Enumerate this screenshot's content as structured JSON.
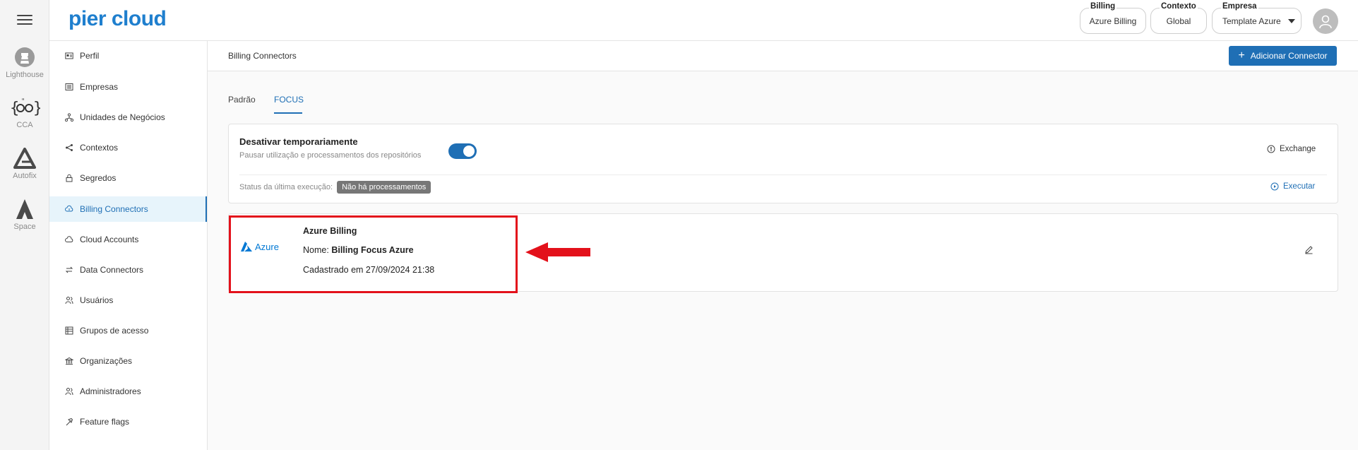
{
  "rail": {
    "items": [
      {
        "label": "Lighthouse",
        "icon": "lighthouse-icon"
      },
      {
        "label": "CCA",
        "icon": "cca-icon"
      },
      {
        "label": "Autofix",
        "icon": "autofix-icon"
      },
      {
        "label": "Space",
        "icon": "space-icon"
      }
    ]
  },
  "header": {
    "logo": "pier cloud",
    "billing_label": "Billing",
    "billing_value": "Azure Billing",
    "context_label": "Contexto",
    "context_value": "Global",
    "company_label": "Empresa",
    "company_value": "Template Azure"
  },
  "sidebar": {
    "items": [
      {
        "label": "Perfil",
        "icon": "id-card-icon"
      },
      {
        "label": "Empresas",
        "icon": "building-icon"
      },
      {
        "label": "Unidades de Negócios",
        "icon": "hierarchy-icon"
      },
      {
        "label": "Contextos",
        "icon": "share-icon"
      },
      {
        "label": "Segredos",
        "icon": "lock-icon"
      },
      {
        "label": "Billing Connectors",
        "icon": "cloud-money-icon"
      },
      {
        "label": "Cloud Accounts",
        "icon": "cloud-icon"
      },
      {
        "label": "Data Connectors",
        "icon": "sync-icon"
      },
      {
        "label": "Usuários",
        "icon": "users-icon"
      },
      {
        "label": "Grupos de acesso",
        "icon": "group-icon"
      },
      {
        "label": "Organizações",
        "icon": "bank-icon"
      },
      {
        "label": "Administradores",
        "icon": "admin-icon"
      },
      {
        "label": "Feature flags",
        "icon": "flag-icon"
      }
    ],
    "active": "Billing Connectors"
  },
  "page": {
    "breadcrumb": "Billing Connectors",
    "add_button": "Adicionar Connector",
    "tabs": [
      "Padrão",
      "FOCUS"
    ],
    "active_tab": "FOCUS"
  },
  "settings_card": {
    "title": "Desativar temporariamente",
    "subtitle": "Pausar utilização e processamentos dos repositórios",
    "toggle_on": true,
    "exchange_label": "Exchange",
    "status_label": "Status da última execução:",
    "status_badge": "Não há processamentos",
    "execute_label": "Executar"
  },
  "connector": {
    "provider_logo_text": "Azure",
    "name": "Azure Billing",
    "nome_label": "Nome:",
    "nome_value": "Billing Focus Azure",
    "registered": "Cadastrado em 27/09/2024 21:38"
  },
  "colors": {
    "brand": "#1f7fce",
    "primary": "#1f6fb5",
    "annotation": "#e3111b"
  }
}
